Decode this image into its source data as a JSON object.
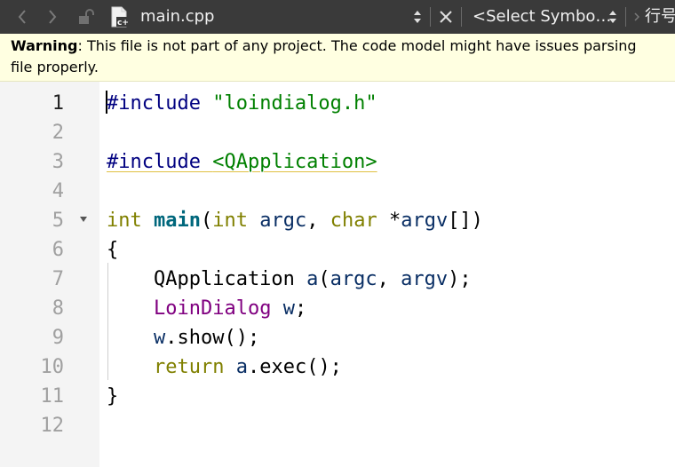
{
  "toolbar": {
    "file_name": "main.cpp",
    "symbol_select": "<Select Symbo…",
    "line_label": "行号"
  },
  "warning": {
    "label": "Warning",
    "line1_rest": ": This file is not part of any project. The code model might have issues parsing",
    "line2": "file properly."
  },
  "editor": {
    "current_line": 1,
    "line_numbers": [
      "1",
      "2",
      "3",
      "4",
      "5",
      "6",
      "7",
      "8",
      "9",
      "10",
      "11",
      "12"
    ],
    "lines": [
      [
        {
          "t": "#include ",
          "c": "pre"
        },
        {
          "t": "\"loindialog.h\"",
          "c": "str"
        }
      ],
      [],
      [
        {
          "t": "#include ",
          "c": "pre",
          "u": true
        },
        {
          "t": "<QApplication>",
          "c": "str",
          "u": true
        }
      ],
      [],
      [
        {
          "t": "int",
          "c": "kw"
        },
        {
          "t": " ",
          "c": "plain"
        },
        {
          "t": "main",
          "c": "fn"
        },
        {
          "t": "(",
          "c": "punc"
        },
        {
          "t": "int",
          "c": "kw"
        },
        {
          "t": " ",
          "c": "plain"
        },
        {
          "t": "argc",
          "c": "var"
        },
        {
          "t": ", ",
          "c": "punc"
        },
        {
          "t": "char",
          "c": "kw"
        },
        {
          "t": " *",
          "c": "punc"
        },
        {
          "t": "argv",
          "c": "var"
        },
        {
          "t": "[])",
          "c": "punc"
        }
      ],
      [
        {
          "t": "{",
          "c": "punc"
        }
      ],
      [
        {
          "t": "    QApplication ",
          "c": "plain"
        },
        {
          "t": "a",
          "c": "local"
        },
        {
          "t": "(",
          "c": "punc"
        },
        {
          "t": "argc",
          "c": "var"
        },
        {
          "t": ", ",
          "c": "punc"
        },
        {
          "t": "argv",
          "c": "var"
        },
        {
          "t": ");",
          "c": "punc"
        }
      ],
      [
        {
          "t": "    ",
          "c": "plain"
        },
        {
          "t": "LoinDialog",
          "c": "type"
        },
        {
          "t": " ",
          "c": "plain"
        },
        {
          "t": "w",
          "c": "local"
        },
        {
          "t": ";",
          "c": "punc"
        }
      ],
      [
        {
          "t": "    ",
          "c": "plain"
        },
        {
          "t": "w",
          "c": "local"
        },
        {
          "t": ".show();",
          "c": "punc"
        }
      ],
      [
        {
          "t": "    ",
          "c": "plain"
        },
        {
          "t": "return",
          "c": "kw"
        },
        {
          "t": " ",
          "c": "plain"
        },
        {
          "t": "a",
          "c": "local"
        },
        {
          "t": ".exec();",
          "c": "punc"
        }
      ],
      [
        {
          "t": "}",
          "c": "punc"
        }
      ],
      []
    ]
  },
  "colors": {
    "toolbar_bg": "#3a3a3a",
    "warning_bg": "#ffffe1",
    "gutter_bg": "#f4f4f4",
    "preprocessor": "#000080",
    "string": "#008000",
    "keyword": "#808000",
    "function": "#00677c",
    "type": "#800080",
    "variable": "#092e64"
  },
  "icons": [
    "chevron-left-icon",
    "chevron-right-icon",
    "unlock-icon",
    "cpp-file-icon",
    "updown-icon",
    "close-icon"
  ]
}
